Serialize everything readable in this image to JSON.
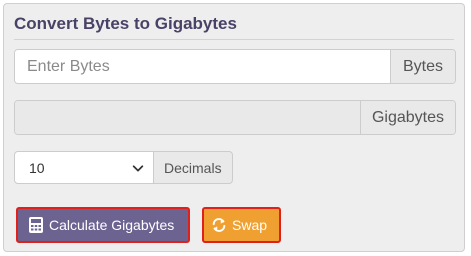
{
  "converter": {
    "title": "Convert Bytes to Gigabytes",
    "bytes_input": {
      "placeholder": "Enter Bytes",
      "value": "",
      "unit": "Bytes"
    },
    "gigabytes_output": {
      "value": "",
      "unit": "Gigabytes"
    },
    "decimals": {
      "selected": "10",
      "label": "Decimals"
    },
    "buttons": {
      "calculate": {
        "label": "Calculate Gigabytes",
        "icon": "calculator-icon"
      },
      "swap": {
        "label": "Swap",
        "icon": "swap-icon"
      }
    },
    "colors": {
      "title": "#4a4266",
      "calculate_bg": "#6d6391",
      "swap_bg": "#f0a030",
      "highlight_border": "#e0201a"
    }
  }
}
